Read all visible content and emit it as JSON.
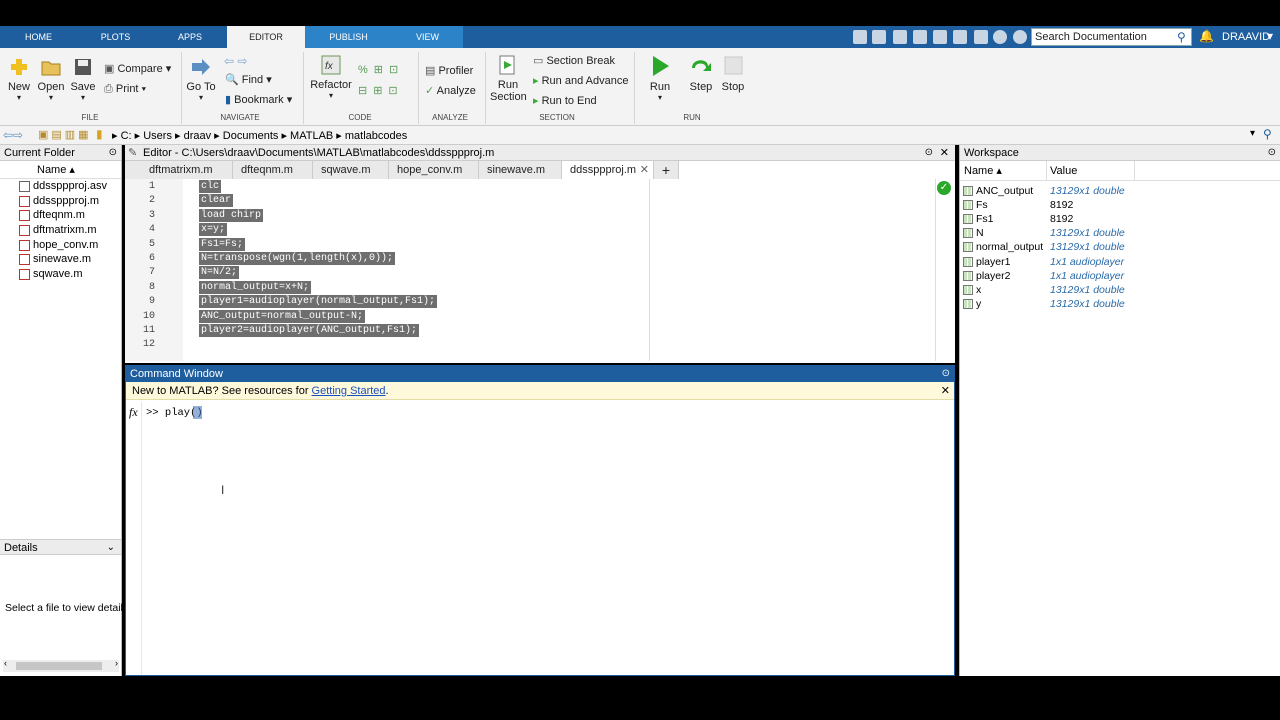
{
  "tabs": [
    "HOME",
    "PLOTS",
    "APPS",
    "EDITOR",
    "PUBLISH",
    "VIEW"
  ],
  "search_placeholder": "Search Documentation",
  "user": "DRAAVID",
  "ribbon": {
    "new": "New",
    "open": "Open",
    "save": "Save",
    "compare": "Compare",
    "print": "Print",
    "file": "FILE",
    "goto_1": "Go To",
    "goto_2": "",
    "find": "Find",
    "bookmark": "Bookmark",
    "navigate": "NAVIGATE",
    "refactor": "Refactor",
    "code": "CODE",
    "profiler": "Profiler",
    "analyze_btn": "Analyze",
    "analyze": "ANALYZE",
    "run_section_1": "Run",
    "run_section_2": "Section",
    "section_break": "Section Break",
    "run_and_advance": "Run and Advance",
    "run_to_end": "Run to End",
    "section": "SECTION",
    "run": "Run",
    "step": "Step",
    "stop": "Stop",
    "run_group": "RUN"
  },
  "path": [
    "C:",
    "Users",
    "draav",
    "Documents",
    "MATLAB",
    "matlabcodes"
  ],
  "current_folder": {
    "title": "Current Folder",
    "col": "Name ▴",
    "files": [
      "ddssppproj.asv",
      "ddssppproj.m",
      "dfteqnm.m",
      "dftmatrixm.m",
      "hope_conv.m",
      "sinewave.m",
      "sqwave.m"
    ]
  },
  "details": {
    "title": "Details",
    "text": "Select a file to view detail:"
  },
  "editor": {
    "title": "Editor - C:\\Users\\draav\\Documents\\MATLAB\\matlabcodes\\ddssppproj.m",
    "tabs": [
      "dftmatrixm.m",
      "dfteqnm.m",
      "sqwave.m",
      "hope_conv.m",
      "sinewave.m",
      "ddssppproj.m"
    ],
    "line_numbers": [
      "1",
      "2",
      "3",
      "4",
      "5",
      "6",
      "7",
      "8",
      "9",
      "10",
      "11",
      "12"
    ],
    "lines": [
      "clc",
      "clear",
      "load chirp",
      "x=y;",
      "Fs1=Fs;",
      "N=transpose(wgn(1,length(x),0));",
      "N=N/2;",
      "normal_output=x+N;",
      "player1=audioplayer(normal_output,Fs1);",
      "ANC_output=normal_output-N;",
      "player2=audioplayer(ANC_output,Fs1);"
    ]
  },
  "command": {
    "title": "Command Window",
    "banner_text": "New to MATLAB? See resources for ",
    "banner_link": "Getting Started",
    "banner_end": ".",
    "fx": "fx",
    "prompt": ">> play()"
  },
  "workspace": {
    "title": "Workspace",
    "col_name": "Name ▴",
    "col_value": "Value",
    "vars": [
      {
        "name": "ANC_output",
        "value": "13129x1 double"
      },
      {
        "name": "Fs",
        "value": "8192"
      },
      {
        "name": "Fs1",
        "value": "8192"
      },
      {
        "name": "N",
        "value": "13129x1 double"
      },
      {
        "name": "normal_output",
        "value": "13129x1 double"
      },
      {
        "name": "player1",
        "value": "1x1 audioplayer"
      },
      {
        "name": "player2",
        "value": "1x1 audioplayer"
      },
      {
        "name": "x",
        "value": "13129x1 double"
      },
      {
        "name": "y",
        "value": "13129x1 double"
      }
    ]
  }
}
